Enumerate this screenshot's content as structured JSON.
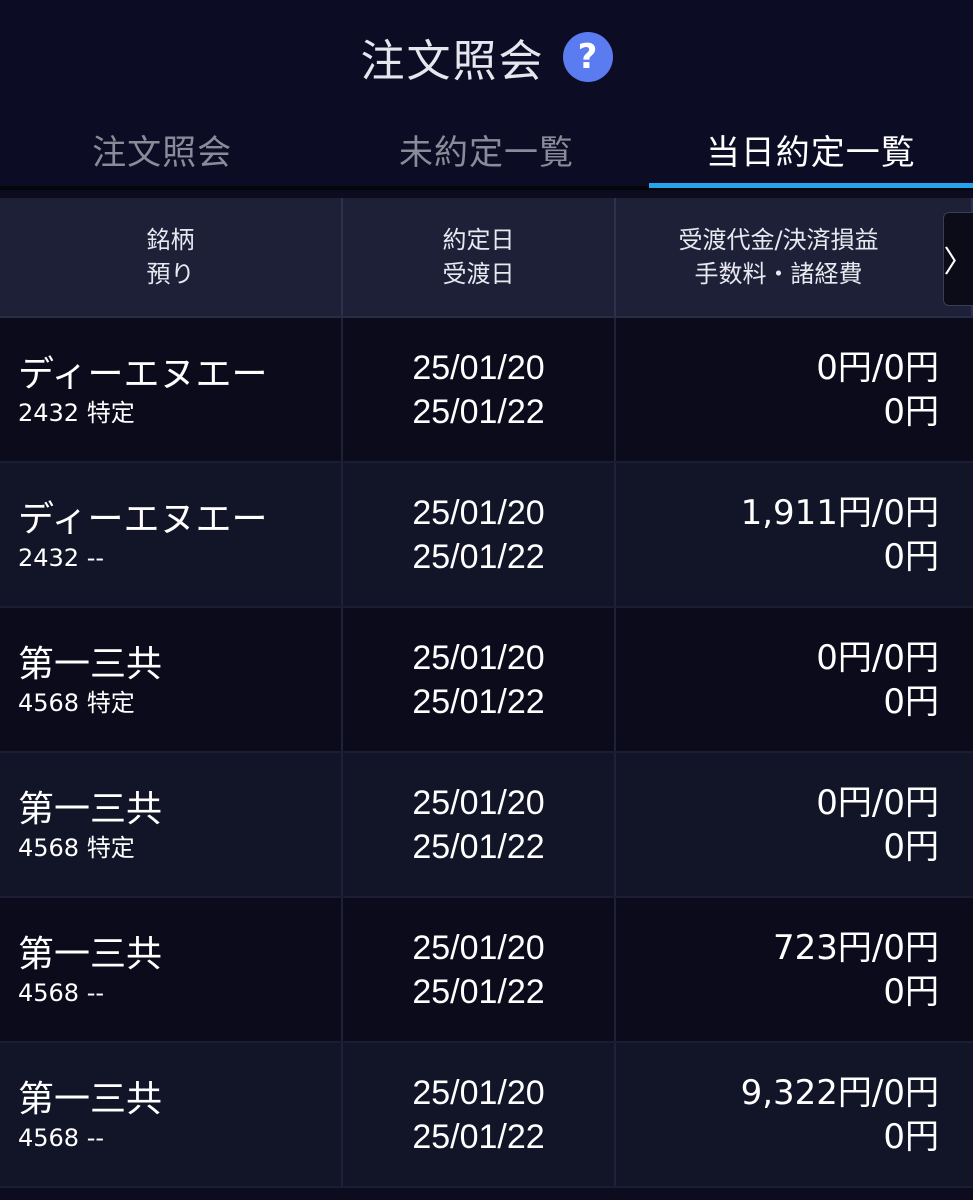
{
  "header": {
    "title": "注文照会",
    "help_glyph": "?",
    "help_icon": "question-circle-icon",
    "accent": "#5b7cf0"
  },
  "tabs": [
    {
      "label": "注文照会",
      "active": false
    },
    {
      "label": "未約定一覧",
      "active": false
    },
    {
      "label": "当日約定一覧",
      "active": true
    }
  ],
  "tab_indicator_color": "#27a2ec",
  "table": {
    "headers": [
      {
        "line1": "銘柄",
        "line2": "預り"
      },
      {
        "line1": "約定日",
        "line2": "受渡日"
      },
      {
        "line1": "受渡代金/決済損益",
        "line2": "手数料・諸経費"
      }
    ],
    "scroll_glyph": "〉",
    "rows": [
      {
        "name": "ディーエヌエー",
        "code": "2432 特定",
        "trade_date": "25/01/20",
        "settle_date": "25/01/22",
        "amount": "0円/0円",
        "fee": "0円"
      },
      {
        "name": "ディーエヌエー",
        "code": "2432 --",
        "trade_date": "25/01/20",
        "settle_date": "25/01/22",
        "amount": "1,911円/0円",
        "fee": "0円"
      },
      {
        "name": "第一三共",
        "code": "4568 特定",
        "trade_date": "25/01/20",
        "settle_date": "25/01/22",
        "amount": "0円/0円",
        "fee": "0円"
      },
      {
        "name": "第一三共",
        "code": "4568 特定",
        "trade_date": "25/01/20",
        "settle_date": "25/01/22",
        "amount": "0円/0円",
        "fee": "0円"
      },
      {
        "name": "第一三共",
        "code": "4568 --",
        "trade_date": "25/01/20",
        "settle_date": "25/01/22",
        "amount": "723円/0円",
        "fee": "0円"
      },
      {
        "name": "第一三共",
        "code": "4568 --",
        "trade_date": "25/01/20",
        "settle_date": "25/01/22",
        "amount": "9,322円/0円",
        "fee": "0円"
      }
    ]
  }
}
